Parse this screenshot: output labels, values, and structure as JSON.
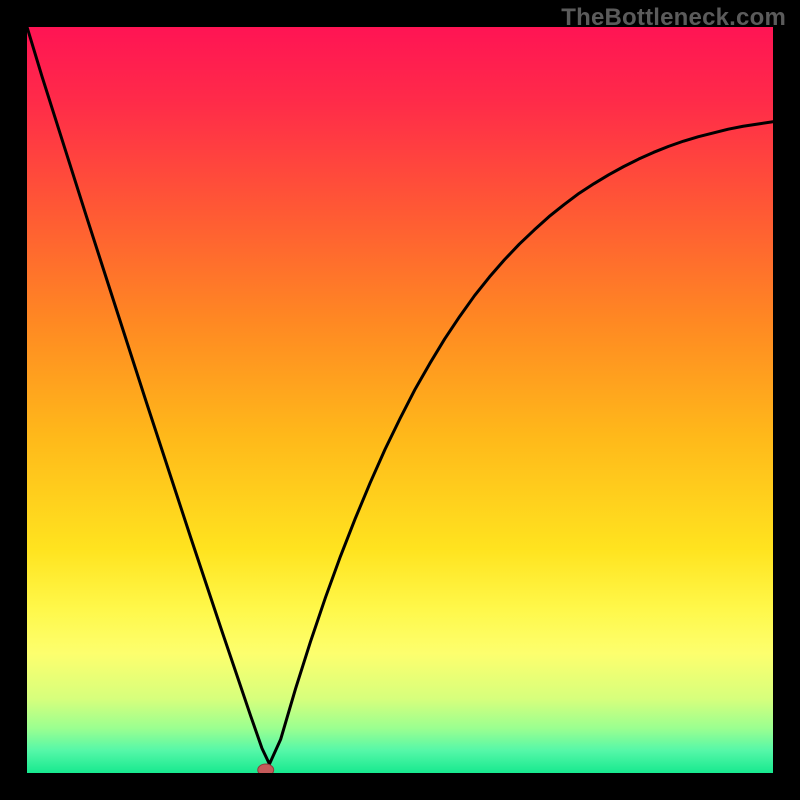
{
  "watermark": "TheBottleneck.com",
  "colors": {
    "frame": "#000000",
    "curve": "#000000",
    "marker_fill": "#c45a5a",
    "marker_stroke": "#8f3c3c",
    "watermark": "#5b5b5b"
  },
  "gradient_stops": [
    {
      "offset": 0.0,
      "color": "#ff1454"
    },
    {
      "offset": 0.1,
      "color": "#ff2b49"
    },
    {
      "offset": 0.25,
      "color": "#ff5a34"
    },
    {
      "offset": 0.4,
      "color": "#ff8a22"
    },
    {
      "offset": 0.55,
      "color": "#ffb91a"
    },
    {
      "offset": 0.7,
      "color": "#ffe31f"
    },
    {
      "offset": 0.78,
      "color": "#fff84a"
    },
    {
      "offset": 0.84,
      "color": "#fdff6e"
    },
    {
      "offset": 0.9,
      "color": "#d7ff7c"
    },
    {
      "offset": 0.94,
      "color": "#9bff90"
    },
    {
      "offset": 0.97,
      "color": "#55f7a8"
    },
    {
      "offset": 1.0,
      "color": "#17e98f"
    }
  ],
  "chart_data": {
    "type": "line",
    "title": "",
    "xlabel": "",
    "ylabel": "",
    "xlim": [
      0,
      100
    ],
    "ylim": [
      0,
      100
    ],
    "marker": {
      "x": 32,
      "y": 0
    },
    "series": [
      {
        "name": "bottleneck-curve",
        "x": [
          0,
          2,
          4,
          6,
          8,
          10,
          12,
          14,
          16,
          18,
          20,
          22,
          24,
          26,
          28,
          30,
          31.5,
          32.5,
          34,
          36,
          38,
          40,
          42,
          44,
          46,
          48,
          50,
          52,
          54,
          56,
          58,
          60,
          62,
          64,
          66,
          68,
          70,
          72,
          74,
          76,
          78,
          80,
          82,
          84,
          86,
          88,
          90,
          92,
          94,
          96,
          98,
          100
        ],
        "y": [
          100,
          93.4,
          87.1,
          80.8,
          74.5,
          68.3,
          62.1,
          55.9,
          49.7,
          43.6,
          37.5,
          31.4,
          25.4,
          19.4,
          13.5,
          7.6,
          3.3,
          1.2,
          4.5,
          11.3,
          17.6,
          23.5,
          29.0,
          34.1,
          38.9,
          43.4,
          47.5,
          51.4,
          54.9,
          58.2,
          61.2,
          64.0,
          66.5,
          68.8,
          70.9,
          72.8,
          74.6,
          76.2,
          77.7,
          79.0,
          80.2,
          81.3,
          82.3,
          83.2,
          84.0,
          84.7,
          85.3,
          85.8,
          86.3,
          86.7,
          87.0,
          87.3
        ]
      }
    ]
  }
}
